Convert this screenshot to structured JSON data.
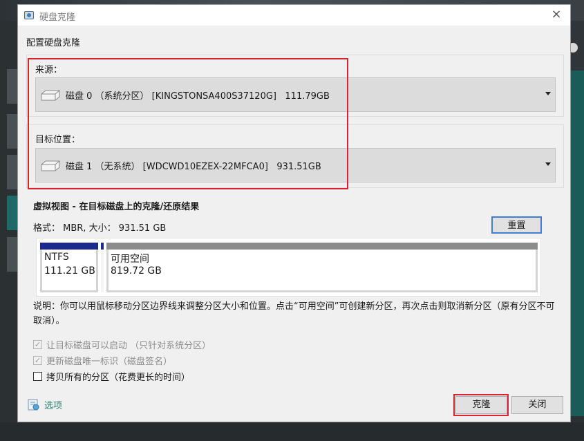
{
  "dialog": {
    "title": "硬盘克隆",
    "close_glyph": "×",
    "section_title": "配置硬盘克隆"
  },
  "source": {
    "label": "来源：",
    "selected": "磁盘 0 （系统分区） [KINGSTONSA400S37120G]   111.79GB"
  },
  "target": {
    "label": "目标位置：",
    "selected": "磁盘 1 （无系统） [WDCWD10EZEX-22MFCA0]   931.51GB"
  },
  "virtual_view": {
    "title": "虚拟视图 - 在目标磁盘上的克隆/还原结果",
    "format_line": "格式： MBR, 大小： 931.51 GB",
    "reset_label": "重置",
    "partitions": [
      {
        "name": "NTFS",
        "size": "111.21 GB",
        "color": "#1b2a8d"
      },
      {
        "name": "可用空间",
        "size": "819.72 GB",
        "color": "#8c8c8c"
      }
    ]
  },
  "note": "说明：你可以用鼠标移动分区边界线来调整分区大小和位置。点击“可用空间”可创建新分区，再次点击则取消新分区（原有分区不可取消）。",
  "checkboxes": [
    {
      "label": "让目标磁盘可以启动 （只针对系统分区）",
      "checked": true,
      "disabled": true
    },
    {
      "label": "更新磁盘唯一标识（磁盘签名）",
      "checked": true,
      "disabled": true
    },
    {
      "label": "拷贝所有的分区（花费更长的时间）",
      "checked": false,
      "disabled": false
    }
  ],
  "footer": {
    "options_label": "选项",
    "clone_label": "克隆",
    "close_label": "关闭"
  },
  "colors": {
    "highlight": "#d9232d",
    "accent_link": "#2f7f6f",
    "focus_border": "#3d7fd1"
  },
  "icons": {
    "check_glyph": "✓"
  }
}
